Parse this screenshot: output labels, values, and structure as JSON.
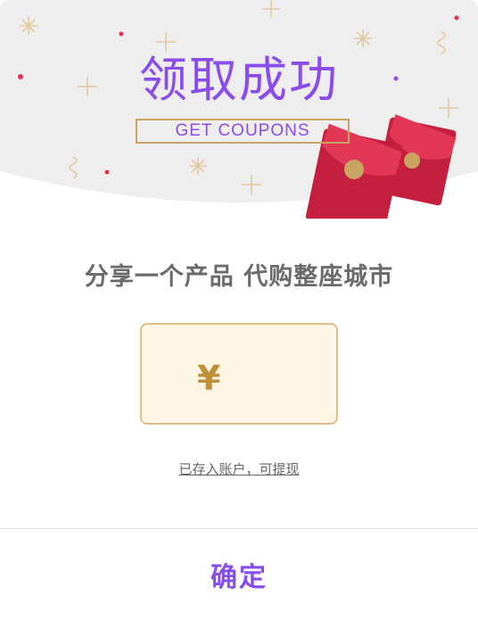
{
  "header": {
    "title": "领取成功",
    "subtitle": "GET  COUPONS"
  },
  "main": {
    "headline": "分享一个产品 代购整座城市",
    "amount": {
      "currency": "¥",
      "value": ""
    },
    "note": "已存入账户，可提现"
  },
  "footer": {
    "confirm_label": "确定"
  },
  "colors": {
    "accent": "#8a4dec",
    "gold": "#c9a463",
    "envelope_red": "#d32b48",
    "header_bg": "#eeeeee"
  },
  "icons": [
    "sparkle-icon",
    "red-envelope-icon"
  ]
}
